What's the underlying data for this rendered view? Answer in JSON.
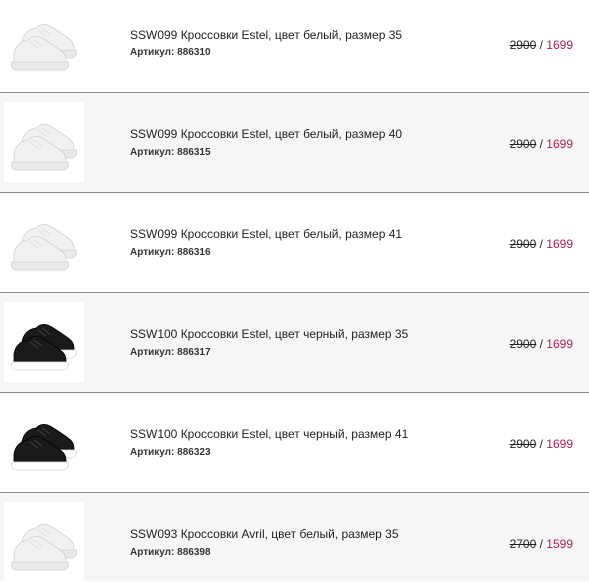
{
  "colors": {
    "accent_price": "#b0204e",
    "divider": "#8a8a8a",
    "row_alt": "#f6f6f6"
  },
  "items": [
    {
      "title": "SSW099 Кроссовки Estel, цвет белый, размер 35",
      "sku_label": "Артикул:",
      "sku": "886310",
      "old_price": "2900",
      "separator": " / ",
      "new_price": "1699",
      "shoe_color": "white"
    },
    {
      "title": "SSW099 Кроссовки Estel, цвет белый, размер 40",
      "sku_label": "Артикул:",
      "sku": "886315",
      "old_price": "2900",
      "separator": " / ",
      "new_price": "1699",
      "shoe_color": "white"
    },
    {
      "title": "SSW099 Кроссовки Estel, цвет белый, размер 41",
      "sku_label": "Артикул:",
      "sku": "886316",
      "old_price": "2900",
      "separator": " / ",
      "new_price": "1699",
      "shoe_color": "white"
    },
    {
      "title": "SSW100 Кроссовки Estel, цвет черный, размер 35",
      "sku_label": "Артикул:",
      "sku": "886317",
      "old_price": "2900",
      "separator": " / ",
      "new_price": "1699",
      "shoe_color": "black"
    },
    {
      "title": "SSW100 Кроссовки Estel, цвет черный, размер 41",
      "sku_label": "Артикул:",
      "sku": "886323",
      "old_price": "2900",
      "separator": " / ",
      "new_price": "1699",
      "shoe_color": "black"
    },
    {
      "title": "SSW093 Кроссовки Avril, цвет белый, размер 35",
      "sku_label": "Артикул:",
      "sku": "886398",
      "old_price": "2700",
      "separator": " / ",
      "new_price": "1599",
      "shoe_color": "white"
    }
  ]
}
